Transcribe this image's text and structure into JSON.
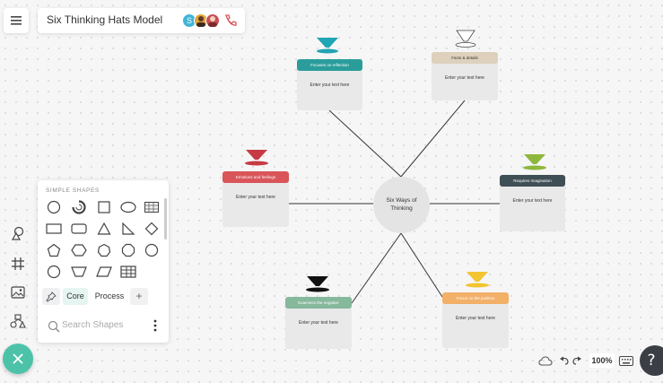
{
  "document": {
    "title": "Six Thinking Hats Model",
    "collaborator_initial": "S"
  },
  "diagram": {
    "center_label": "Six Ways of Thinking",
    "cards": [
      {
        "header": "Focuses on reflection",
        "body": "Enter your text here",
        "color": "#2a9d9b",
        "hat_color": "#20a5b5"
      },
      {
        "header": "Facts & details",
        "body": "Enter your text here",
        "color": "#ddd1bd",
        "hat_color": "#ffffff"
      },
      {
        "header": "Emotions and feelings",
        "body": "Enter your text here",
        "color": "#d9555a",
        "hat_color": "#c73a44"
      },
      {
        "header": "Requires Imagination",
        "body": "Enter your text here",
        "color": "#3e4f55",
        "hat_color": "#8eb83d"
      },
      {
        "header": "Examines the negative",
        "body": "Enter your text here",
        "color": "#86b89c",
        "hat_color": "#111111"
      },
      {
        "header": "Focus on the positive",
        "body": "Enter your text here",
        "color": "#f2b069",
        "hat_color": "#f2c531"
      }
    ]
  },
  "shapes_panel": {
    "section_title": "SIMPLE SHAPES",
    "tabs": {
      "pin_icon": "pin-icon",
      "core": "Core",
      "process": "Process",
      "add": "+"
    },
    "search_placeholder": "Search Shapes"
  },
  "bottom_bar": {
    "zoom": "100%"
  }
}
